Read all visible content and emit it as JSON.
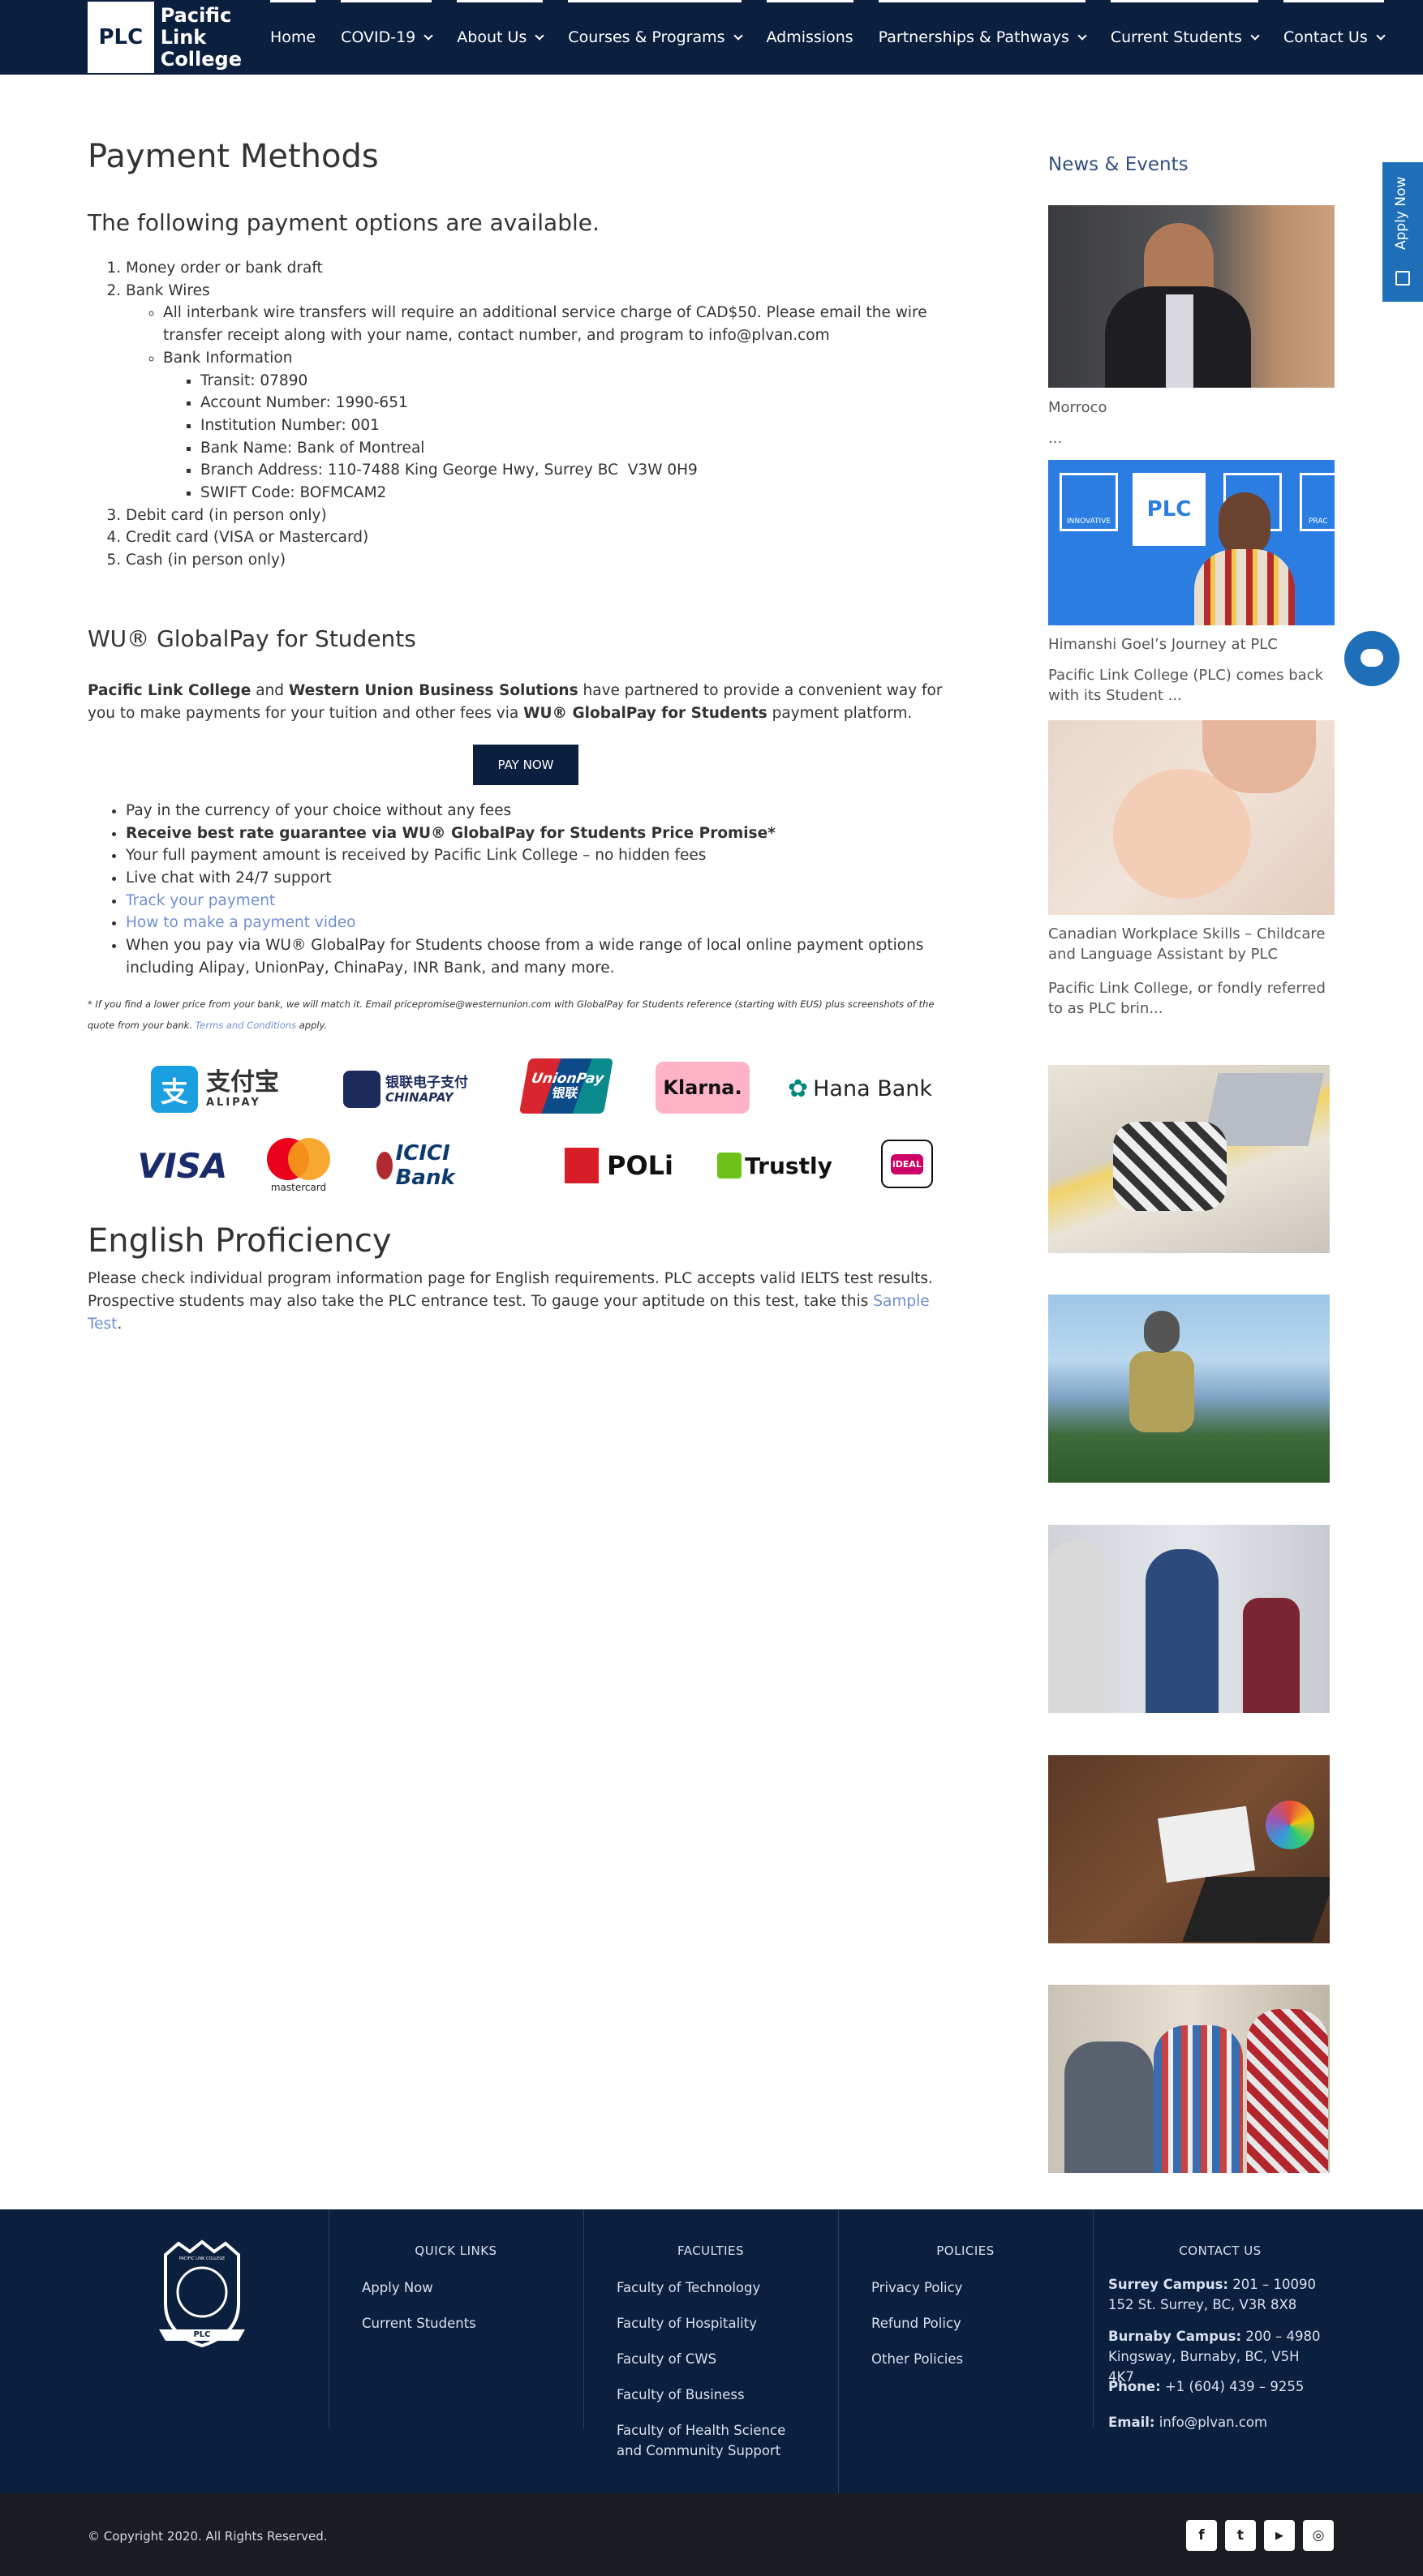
{
  "header": {
    "logo_box": "PLC",
    "logo_text": "Pacific\nLink\nCollege",
    "nav": [
      {
        "label": "Home",
        "chevron": false
      },
      {
        "label": "COVID-19",
        "chevron": true
      },
      {
        "label": "About Us",
        "chevron": true
      },
      {
        "label": "Courses & Programs",
        "chevron": true
      },
      {
        "label": "Admissions",
        "chevron": false
      },
      {
        "label": "Partnerships & Pathways",
        "chevron": true
      },
      {
        "label": "Current Students",
        "chevron": true
      },
      {
        "label": "Contact Us",
        "chevron": true
      }
    ]
  },
  "main": {
    "title": "Payment Methods",
    "lead": "The following payment options are available.",
    "methods": {
      "m1": "Money order or bank draft",
      "m2": "Bank Wires",
      "wire_note": "All interbank wire transfers will require an additional service charge of CAD$50. Please email the wire transfer receipt along with your name, contact number, and program to info@plvan.com",
      "bank_info": "Bank Information",
      "transit": "Transit: 07890",
      "account": "Account Number: 1990-651",
      "institution": "Institution Number: 001",
      "bank_name": "Bank Name: Bank of Montreal",
      "branch": "Branch Address: 110-7488 King George Hwy, Surrey BC  V3W 0H9",
      "swift": "SWIFT Code: BOFMCAM2",
      "m3": "Debit card (in person only)",
      "m4": "Credit card (VISA or Mastercard)",
      "m5": "Cash (in person only)"
    },
    "wu": {
      "heading": "WU® GlobalPay for Students",
      "p_a": "Pacific Link College",
      "p_b": " and ",
      "p_c": "Western Union Business Solutions",
      "p_d": " have partnered to provide a convenient way for you to make payments for your tuition and other fees via ",
      "p_e": "WU® GlobalPay for Students",
      "p_f": " payment platform.",
      "pay_now": "PAY NOW",
      "features": {
        "f1": "Pay in the currency of your choice without any fees",
        "f2": "Receive best rate guarantee via WU® GlobalPay for Students Price Promise*",
        "f3": "Your full payment amount is received by Pacific Link College – no hidden fees",
        "f4": "Live chat with 24/7 support",
        "f5": "Track your payment",
        "f6": "How to make a payment video",
        "f7": "When you pay via WU® GlobalPay for Students choose from a wide range of local online payment options including Alipay, UnionPay, ChinaPay, INR Bank, and many more."
      },
      "note_a": "* If you find a lower price from your bank, we will match it. Email pricepromise@westernunion.com with GlobalPay for Students reference (starting with EUS) plus screenshots of the quote from your bank. ",
      "note_link": "Terms and Conditions",
      "note_b": " apply."
    },
    "payment_logos": {
      "alipay": "支付宝",
      "alipay_sub": "ALIPAY",
      "chinapay": "银联电子支付",
      "chinapay_sub": "CHINAPAY",
      "unionpay": "UnionPay",
      "unionpay_sub": "银联",
      "klarna": "Klarna.",
      "hanabank": "Hana Bank",
      "visa": "VISA",
      "mastercard": "mastercard",
      "icici": "ICICI Bank",
      "poli": "POLi",
      "trustly": "Trustly",
      "ideal": "iDEAL"
    },
    "english": {
      "heading": "English Proficiency",
      "text": "Please check individual program information page for English requirements. PLC accepts valid IELTS test results. Prospective students may also take the PLC entrance test. To gauge your aptitude on this test, take this ",
      "link": "Sample Test",
      "end": "."
    }
  },
  "sidebar": {
    "title": "News & Events",
    "post1_title": "Morroco",
    "post1_excerpt": "...",
    "post2_title": "Himanshi Goel’s Journey at PLC",
    "post2_excerpt": "Pacific Link College (PLC) comes back with its Student ...",
    "post2_banner": "PLC",
    "post2_tag": "INNOVATIVE",
    "post2_tag2": "PRAC",
    "post3_title": "Canadian Workplace Skills – Childcare and Language Assistant by PLC",
    "post3_excerpt": "Pacific Link College, or fondly referred to as PLC brin..."
  },
  "apply_tab": "Apply Now",
  "footer": {
    "seal_top": "PACIFIC LINK COLLEGE",
    "seal_bottom": "PLC",
    "quick_links": {
      "heading": "QUICK LINKS",
      "l1": "Apply Now",
      "l2": "Current Students"
    },
    "faculties": {
      "heading": "FACULTIES",
      "l1": "Faculty of Technology",
      "l2": "Faculty of Hospitality",
      "l3": "Faculty of CWS",
      "l4": "Faculty of Business",
      "l5": "Faculty of Health Science and Community Support"
    },
    "policies": {
      "heading": "POLICIES",
      "l1": "Privacy Policy",
      "l2": "Refund Policy",
      "l3": "Other Policies"
    },
    "contact": {
      "heading": "CONTACT US",
      "surrey_label": "Surrey Campus:",
      "surrey": " 201 – 10090 152 St. Surrey, BC, V3R 8X8",
      "burnaby_label": "Burnaby Campus:",
      "burnaby": " 200 – 4980 Kingsway, Burnaby, BC, V5H 4K7",
      "phone_label": "Phone:",
      "phone": " +1 (604) 439 – 9255",
      "email_label": "Email:",
      "email": " info@plvan.com"
    },
    "copyright": "© Copyright 2020. All Rights Reserved.",
    "social": {
      "facebook": "f",
      "twitter": "t",
      "youtube": "▶",
      "instagram": "◎"
    }
  },
  "colors": {
    "navy": "#0b1f3f",
    "link": "#6e8fd0",
    "accent_blue": "#1e6fb8"
  }
}
